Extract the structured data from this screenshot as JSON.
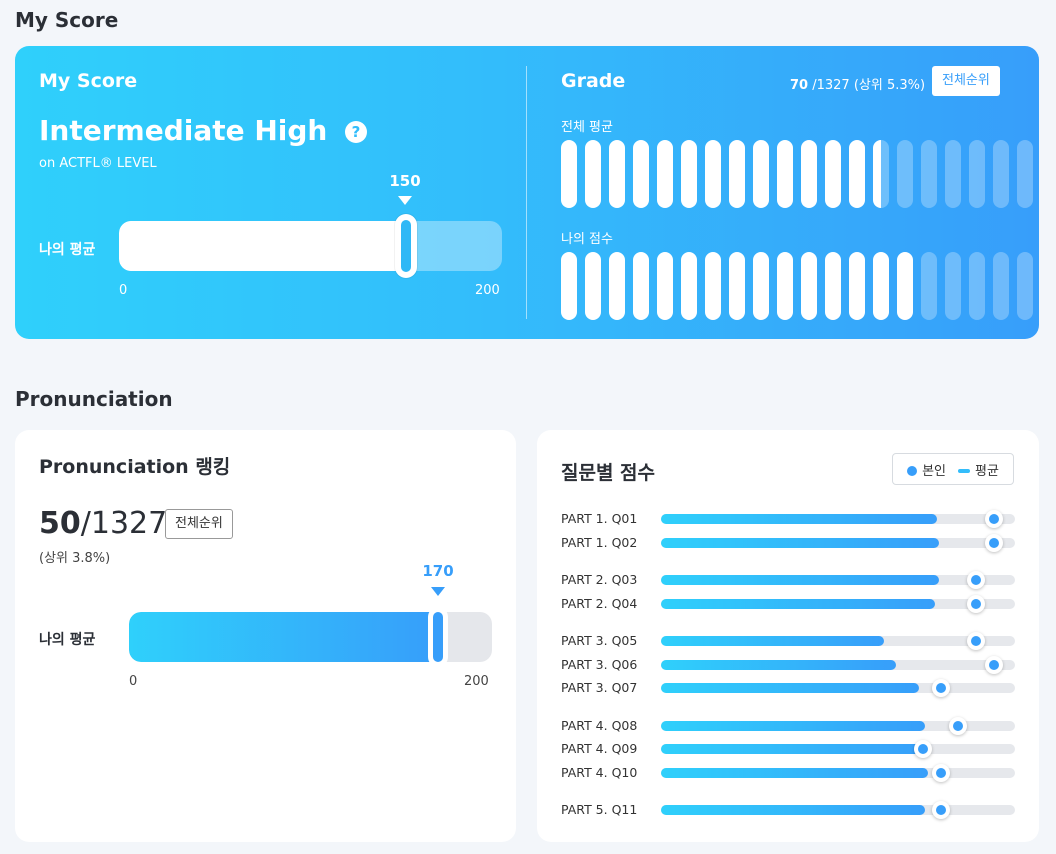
{
  "sections": {
    "myscore_title": "My Score",
    "pronunciation_title": "Pronunciation"
  },
  "score_card": {
    "label": "My Score",
    "level": "Intermediate High",
    "help_icon": "?",
    "sublevel": "on ACTFL® LEVEL",
    "bar_label": "나의 평균",
    "marker_value": "150",
    "min": "0",
    "max": "200",
    "value": 150,
    "max_value": 200
  },
  "grade": {
    "label": "Grade",
    "rank": "70",
    "rank_total": " /1327 (상위 5.3%)",
    "rank_button": "전체순위",
    "overall_label": "전체 평균",
    "my_label": "나의 점수",
    "total_pills": 20,
    "overall_filled": 13.5,
    "my_filled": 15
  },
  "pron_card": {
    "title": "Pronunciation 랭킹",
    "rank": "50",
    "total": "/1327",
    "percent": "(상위 3.8%)",
    "rank_button": "전체순위",
    "bar_label": "나의 평균",
    "marker_value": "170",
    "min": "0",
    "max": "200",
    "value": 170,
    "max_value": 200
  },
  "question_card": {
    "title": "질문별 점수",
    "legend_self": "본인",
    "legend_avg": "평균",
    "questions": [
      {
        "label": "PART 1. Q01",
        "fill": 0.78,
        "dot": 0.94
      },
      {
        "label": "PART 1. Q02",
        "fill": 0.785,
        "dot": 0.94
      },
      {
        "label": "PART 2. Q03",
        "fill": 0.785,
        "dot": 0.89
      },
      {
        "label": "PART 2. Q04",
        "fill": 0.775,
        "dot": 0.89
      },
      {
        "label": "PART 3. Q05",
        "fill": 0.63,
        "dot": 0.89
      },
      {
        "label": "PART 3. Q06",
        "fill": 0.665,
        "dot": 0.94
      },
      {
        "label": "PART 3. Q07",
        "fill": 0.73,
        "dot": 0.79
      },
      {
        "label": "PART 4. Q08",
        "fill": 0.745,
        "dot": 0.84
      },
      {
        "label": "PART 4. Q09",
        "fill": 0.755,
        "dot": 0.74
      },
      {
        "label": "PART 4. Q10",
        "fill": 0.755,
        "dot": 0.79
      },
      {
        "label": "PART 5. Q11",
        "fill": 0.745,
        "dot": 0.79
      }
    ]
  }
}
